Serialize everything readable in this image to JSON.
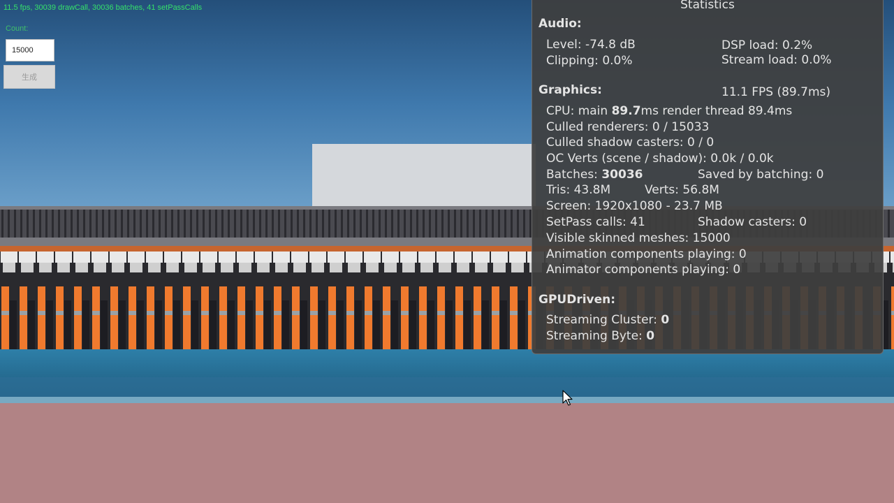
{
  "overlay": {
    "fps_text": "11.5 fps, 30039 drawCall, 30036 batches, 41 setPassCalls",
    "count_label": "Count:",
    "count_value": "15000",
    "generate_label": "生成"
  },
  "stats": {
    "title": "Statistics",
    "audio": {
      "heading": "Audio:",
      "level": "Level: -74.8 dB",
      "dsp_load": "DSP load: 0.2%",
      "clipping": "Clipping: 0.0%",
      "stream_load": "Stream load: 0.0%"
    },
    "graphics": {
      "heading": "Graphics:",
      "fps": "11.1 FPS (89.7ms)",
      "cpu_prefix": "CPU: main ",
      "cpu_main": "89.7",
      "cpu_suffix": "ms  render thread 89.4ms",
      "culled_renderers": "Culled renderers: 0 / 15033",
      "culled_shadow": "Culled shadow casters: 0 / 0",
      "oc_verts": "OC Verts (scene / shadow): 0.0k / 0.0k",
      "batches_prefix": "Batches: ",
      "batches_value": "30036",
      "saved_by_batching": "Saved by batching: 0",
      "tris": "Tris: 43.8M",
      "verts": "Verts: 56.8M",
      "screen": "Screen: 1920x1080 - 23.7 MB",
      "setpass": "SetPass calls: 41",
      "shadow_casters": "Shadow casters: 0",
      "visible_skinned": "Visible skinned meshes: 15000",
      "animation_components": "Animation components playing: 0",
      "animator_components": "Animator components playing: 0"
    },
    "gpudriven": {
      "heading": "GPUDriven:",
      "streaming_cluster_prefix": "Streaming Cluster: ",
      "streaming_cluster_value": "0",
      "streaming_byte_prefix": "Streaming Byte: ",
      "streaming_byte_value": "0"
    }
  }
}
